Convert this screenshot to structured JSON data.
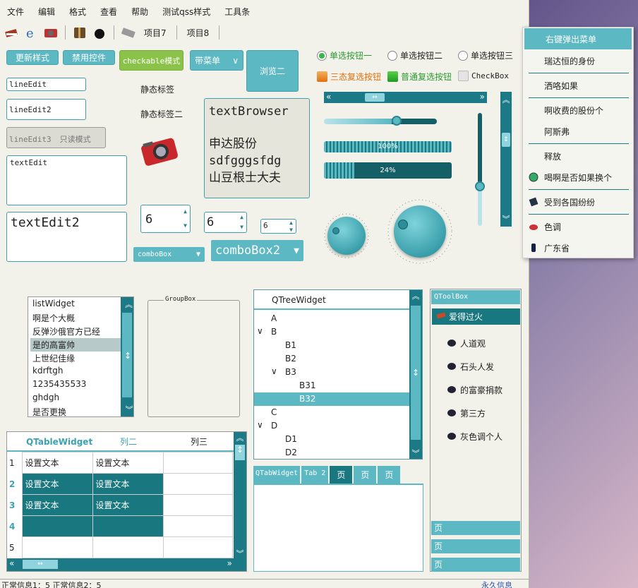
{
  "menubar": {
    "items": [
      "文件",
      "编辑",
      "格式",
      "查看",
      "帮助",
      "测试qss样式",
      "工具条"
    ]
  },
  "toolbar": {
    "item7": "项目7",
    "item8": "项目8"
  },
  "buttons": {
    "update_style": "更新样式",
    "disable": "禁用控件",
    "checkable": "checkable模式",
    "with_menu": "带菜单",
    "browse2": "浏览二"
  },
  "line_edits": {
    "le1": "lineEdit",
    "le2": "lineEdit2",
    "le3": "lineEdit3",
    "readonly": "只读模式"
  },
  "text_edit": {
    "small": "textEdit",
    "large": "textEdit2"
  },
  "labels": {
    "static1": "静态标签",
    "static2": "静态标签二"
  },
  "text_browser": {
    "line1": "textBrowser",
    "line2": "申达股份",
    "line3": "sdfgggsfdg",
    "line4": "山豆根士大夫"
  },
  "spinboxes": {
    "s1": "6",
    "s2": "6",
    "s3": "6"
  },
  "combos": {
    "c1": "comboBox",
    "c2": "comboBox2"
  },
  "radios": {
    "r1": "单选按钮一",
    "r2": "单选按钮二",
    "r3": "单选按钮三"
  },
  "checks": {
    "c1": "三态复选按钮",
    "c2": "普通复选按钮",
    "c3": "CheckBox"
  },
  "progress": {
    "p1_label": "100%",
    "p1_value": 100,
    "p2_label": "24%",
    "p2_value": 24
  },
  "list_widget": {
    "items": [
      "listWidget",
      "啊是个大概",
      "反弹沙俄官方已经",
      "是的高富帅",
      "上世纪佳缘",
      "kdrftgh",
      "1235435533",
      "ghdgh",
      "是否更换"
    ],
    "selected": 3
  },
  "groupbox": {
    "title": "GroupBox"
  },
  "tree": {
    "header": "QTreeWidget",
    "rows": [
      {
        "t": "A",
        "lv": 0,
        "exp": false
      },
      {
        "t": "B",
        "lv": 0,
        "exp": true
      },
      {
        "t": "B1",
        "lv": 1,
        "exp": false
      },
      {
        "t": "B2",
        "lv": 1,
        "exp": false
      },
      {
        "t": "B3",
        "lv": 1,
        "exp": true
      },
      {
        "t": "B31",
        "lv": 2,
        "exp": false
      },
      {
        "t": "B32",
        "lv": 2,
        "exp": false,
        "sel": true
      },
      {
        "t": "C",
        "lv": 0,
        "exp": false
      },
      {
        "t": "D",
        "lv": 0,
        "exp": true
      },
      {
        "t": "D1",
        "lv": 1,
        "exp": false
      },
      {
        "t": "D2",
        "lv": 1,
        "exp": false
      }
    ]
  },
  "table": {
    "headers": [
      "QTableWidget",
      "列二",
      "列三"
    ],
    "row_labels": [
      "1",
      "2",
      "3",
      "4",
      "5"
    ],
    "cell": "设置文本"
  },
  "tabs": {
    "t1": "QTabWidget",
    "t2": "Tab 2",
    "t3": "页",
    "t4": "页",
    "t5": "页"
  },
  "toolbox": {
    "title": "QToolBox",
    "active": "爱得过火",
    "items": [
      "人道观",
      "石头人发",
      "的富豪捐款",
      "第三方",
      "灰色调个人"
    ],
    "pages": [
      "页",
      "页",
      "页"
    ]
  },
  "context_menu": {
    "items": [
      "右键弹出菜单",
      "瑞达恒的身份",
      "洒咯如果",
      "啊收费的股份个",
      "阿斯弗",
      "释放",
      "喝啊是否如果换个",
      "受到各国纷纷",
      "色调",
      "广东省"
    ]
  },
  "status": {
    "left": "正常信息1：5 正常信息2：5",
    "right": "永久信息"
  },
  "colors": {
    "accent": "#5cb8c3",
    "dark_teal": "#18777f",
    "bg": "#f3f2ea"
  }
}
